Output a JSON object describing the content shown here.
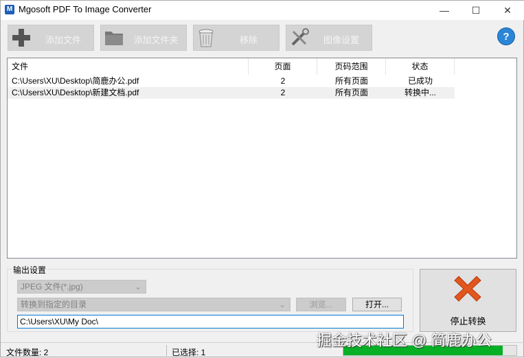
{
  "window": {
    "title": "Mgosoft PDF To Image Converter",
    "minimize": "—",
    "maximize": "☐",
    "close": "✕"
  },
  "toolbar": {
    "add_file": "添加文件",
    "add_folder": "添加文件夹",
    "remove": "移除",
    "image_settings": "图像设置",
    "help": "?"
  },
  "list": {
    "columns": [
      "文件",
      "页面",
      "页码范围",
      "状态"
    ],
    "rows": [
      {
        "file": "C:\\Users\\XU\\Desktop\\简鹿办公.pdf",
        "pages": "2",
        "range": "所有页面",
        "status": "已成功"
      },
      {
        "file": "C:\\Users\\XU\\Desktop\\新建文档.pdf",
        "pages": "2",
        "range": "所有页面",
        "status": "转换中..."
      }
    ]
  },
  "output": {
    "group_label": "输出设置",
    "format": "JPEG 文件(*.jpg)",
    "destination": "转换到指定的目录",
    "browse": "浏览...",
    "open": "打开...",
    "path": "C:\\Users\\XU\\My Doc\\",
    "stop": "停止转换"
  },
  "status": {
    "file_count": "文件数量: 2",
    "selected": "已选择: 1",
    "progress": 0.92,
    "progress_color": "#06b025"
  },
  "watermark": "掘金技术社区 @ 简鹿办公"
}
